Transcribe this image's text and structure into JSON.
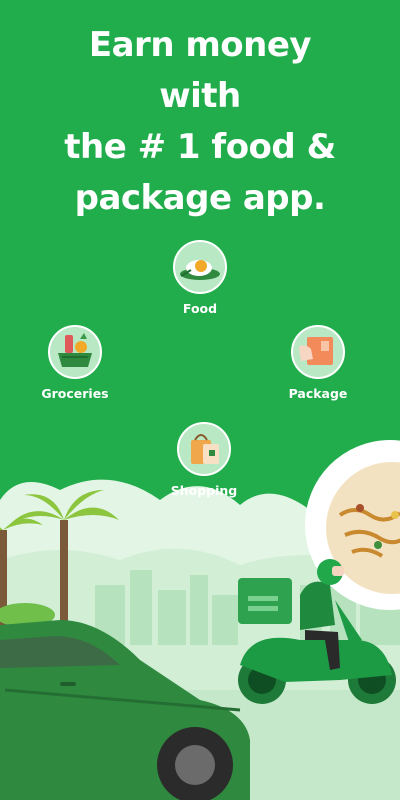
{
  "headline": {
    "line1": "Earn money",
    "line2": "with",
    "line3": "the # 1 food &",
    "line4": "package app."
  },
  "categories": [
    {
      "label": "Food",
      "icon": "food-plate-icon"
    },
    {
      "label": "Groceries",
      "icon": "groceries-basket-icon"
    },
    {
      "label": "Package",
      "icon": "package-box-icon"
    },
    {
      "label": "Shopping",
      "icon": "shopping-bag-icon"
    }
  ],
  "colors": {
    "background": "#21ad4c",
    "icon_circle": "#b9e8c5",
    "text": "#ffffff"
  }
}
